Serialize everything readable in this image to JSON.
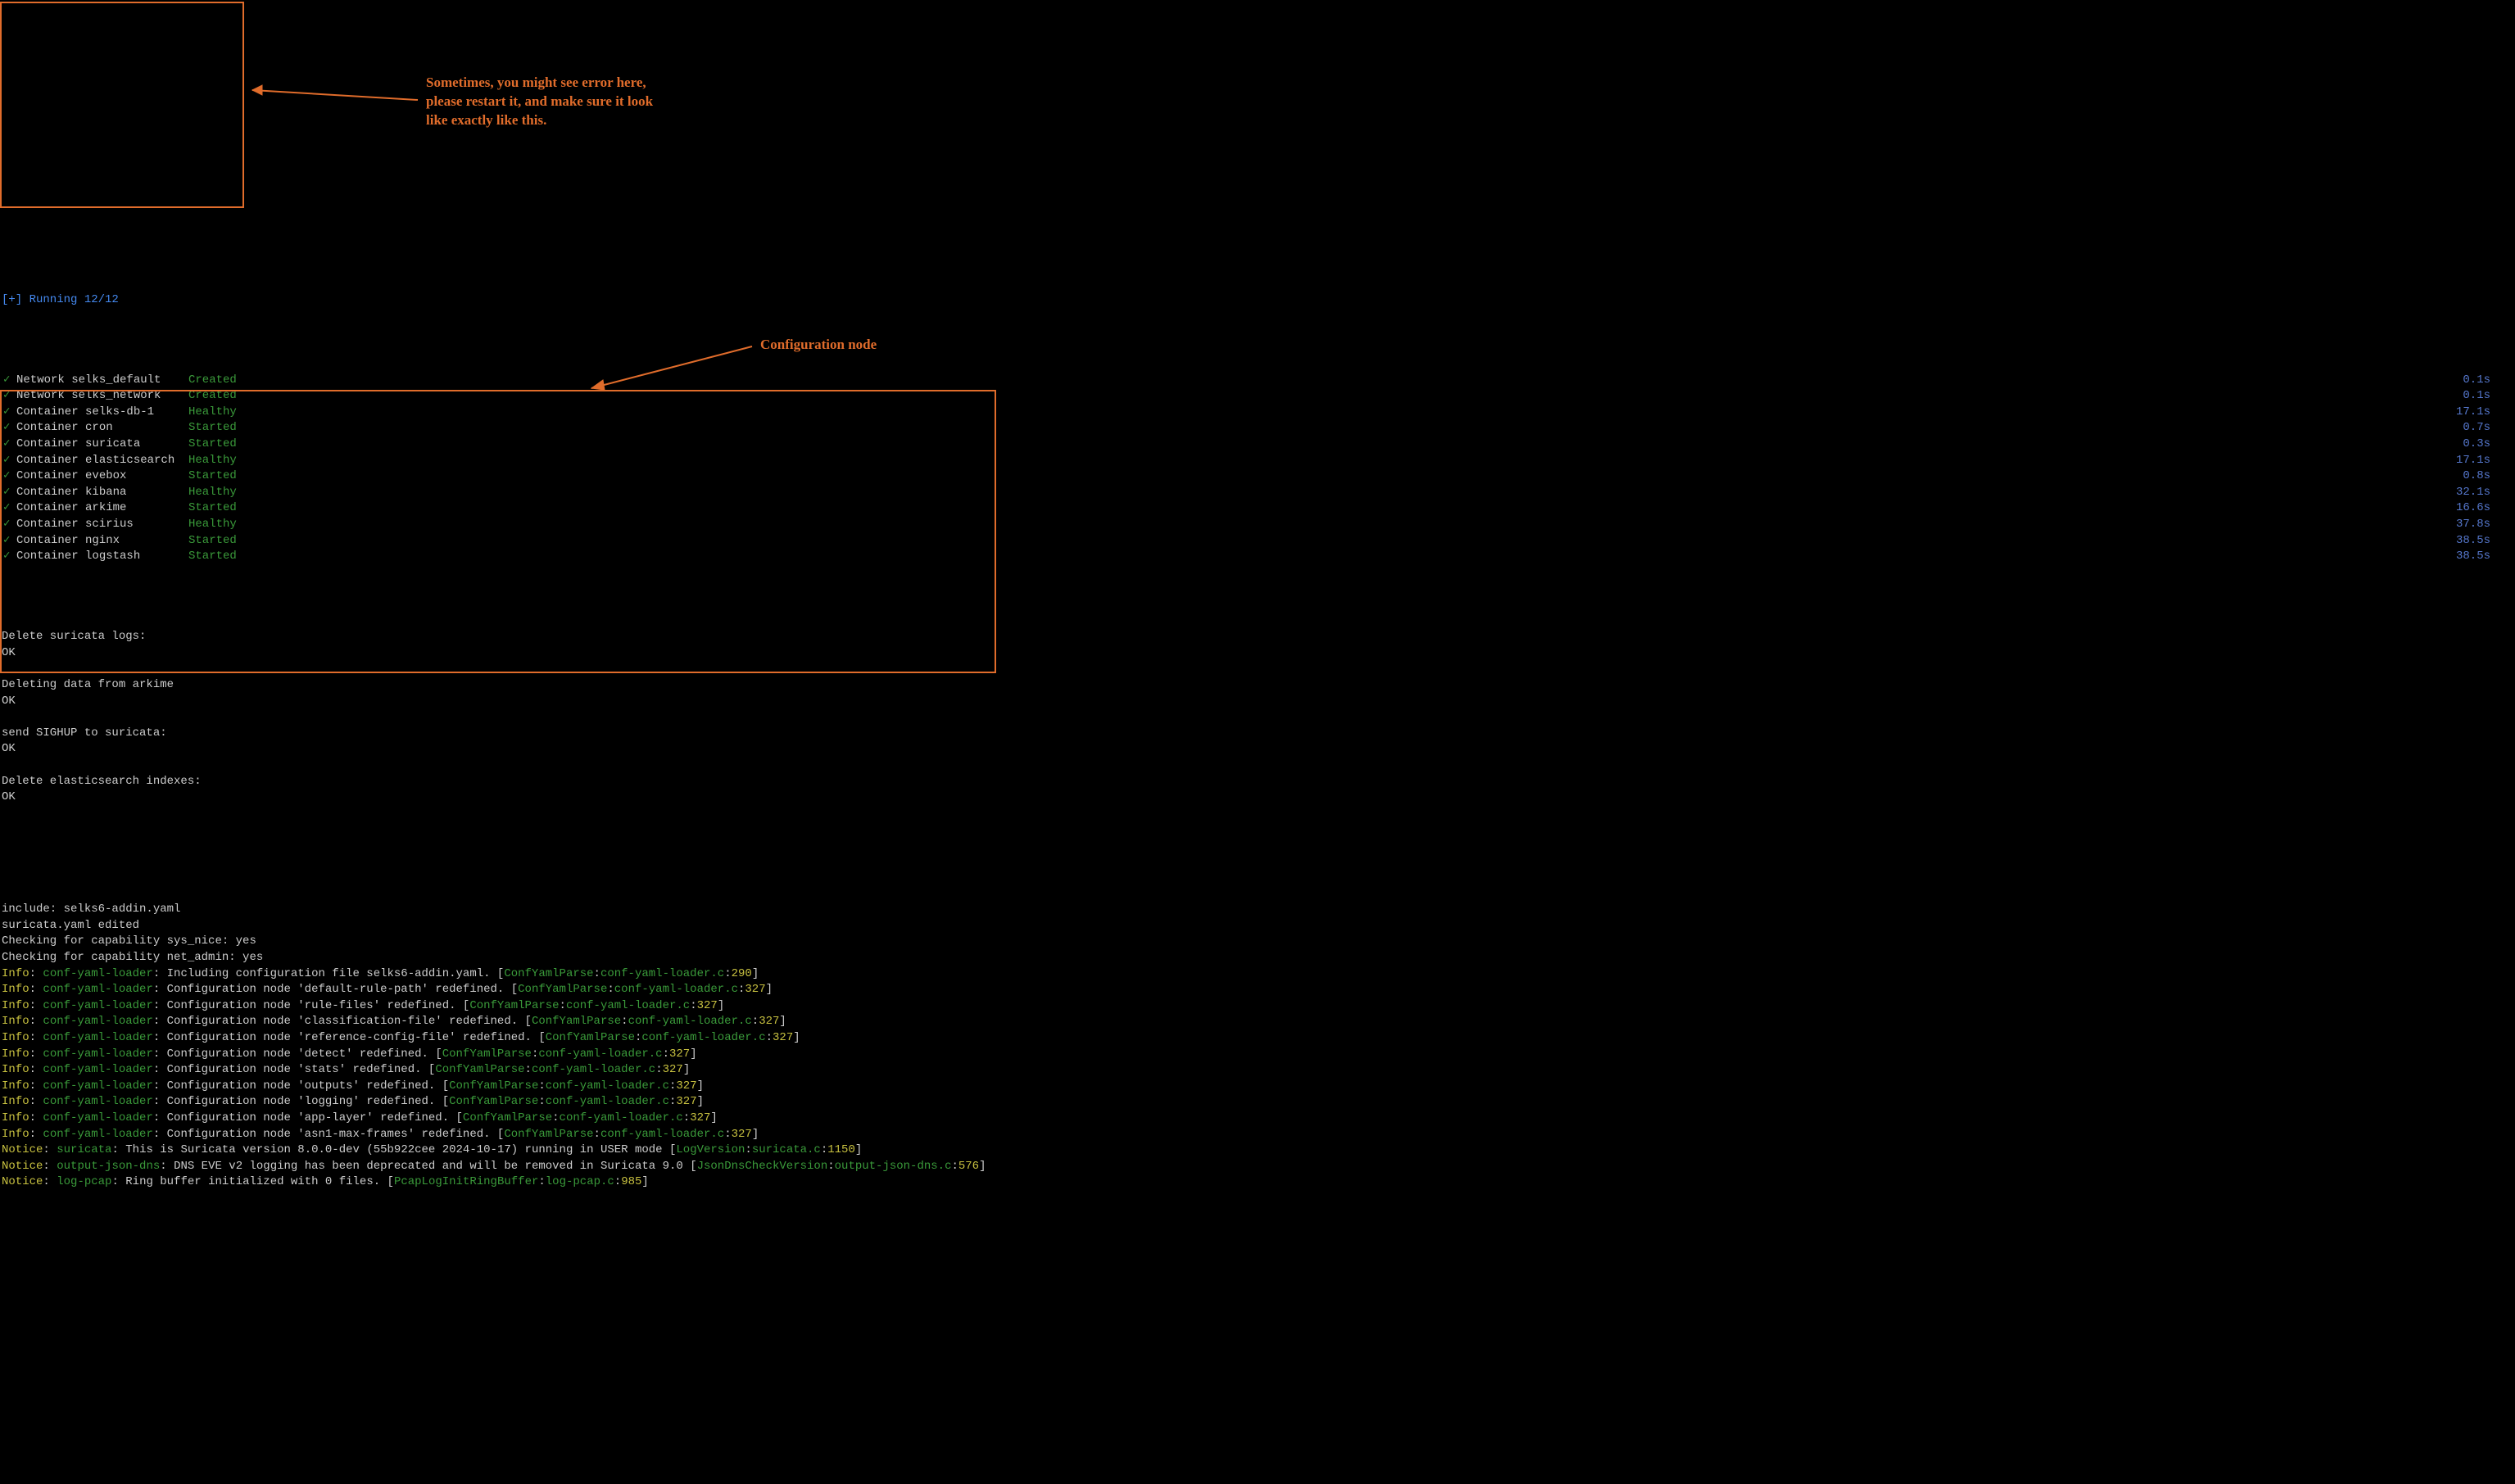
{
  "running": {
    "header": "[+] Running 12/12",
    "services": [
      {
        "name": "Network selks_default",
        "status": "Created",
        "time": "0.1s"
      },
      {
        "name": "Network selks_network",
        "status": "Created",
        "time": "0.1s"
      },
      {
        "name": "Container selks-db-1",
        "status": "Healthy",
        "time": "17.1s"
      },
      {
        "name": "Container cron",
        "status": "Started",
        "time": "0.7s"
      },
      {
        "name": "Container suricata",
        "status": "Started",
        "time": "0.3s"
      },
      {
        "name": "Container elasticsearch",
        "status": "Healthy",
        "time": "17.1s"
      },
      {
        "name": "Container evebox",
        "status": "Started",
        "time": "0.8s"
      },
      {
        "name": "Container kibana",
        "status": "Healthy",
        "time": "32.1s"
      },
      {
        "name": "Container arkime",
        "status": "Started",
        "time": "16.6s"
      },
      {
        "name": "Container scirius",
        "status": "Healthy",
        "time": "37.8s"
      },
      {
        "name": "Container nginx",
        "status": "Started",
        "time": "38.5s"
      },
      {
        "name": "Container logstash",
        "status": "Started",
        "time": "38.5s"
      }
    ]
  },
  "plain_lines": [
    "Delete suricata logs:",
    "OK",
    "",
    "Deleting data from arkime",
    "OK",
    "",
    "send SIGHUP to suricata:",
    "OK",
    "",
    "Delete elasticsearch indexes:",
    "OK",
    "",
    ""
  ],
  "config_pre": [
    "include: selks6-addin.yaml",
    "suricata.yaml edited",
    "Checking for capability sys_nice: yes",
    "Checking for capability net_admin: yes"
  ],
  "config_logs": [
    {
      "level": "Info",
      "component": "conf-yaml-loader",
      "msg": "Including configuration file selks6-addin.yaml.",
      "fn": "ConfYamlParse",
      "file": "conf-yaml-loader.c",
      "line": "290"
    },
    {
      "level": "Info",
      "component": "conf-yaml-loader",
      "msg": "Configuration node 'default-rule-path' redefined.",
      "fn": "ConfYamlParse",
      "file": "conf-yaml-loader.c",
      "line": "327"
    },
    {
      "level": "Info",
      "component": "conf-yaml-loader",
      "msg": "Configuration node 'rule-files' redefined.",
      "fn": "ConfYamlParse",
      "file": "conf-yaml-loader.c",
      "line": "327"
    },
    {
      "level": "Info",
      "component": "conf-yaml-loader",
      "msg": "Configuration node 'classification-file' redefined.",
      "fn": "ConfYamlParse",
      "file": "conf-yaml-loader.c",
      "line": "327"
    },
    {
      "level": "Info",
      "component": "conf-yaml-loader",
      "msg": "Configuration node 'reference-config-file' redefined.",
      "fn": "ConfYamlParse",
      "file": "conf-yaml-loader.c",
      "line": "327"
    },
    {
      "level": "Info",
      "component": "conf-yaml-loader",
      "msg": "Configuration node 'detect' redefined.",
      "fn": "ConfYamlParse",
      "file": "conf-yaml-loader.c",
      "line": "327"
    },
    {
      "level": "Info",
      "component": "conf-yaml-loader",
      "msg": "Configuration node 'stats' redefined.",
      "fn": "ConfYamlParse",
      "file": "conf-yaml-loader.c",
      "line": "327"
    },
    {
      "level": "Info",
      "component": "conf-yaml-loader",
      "msg": "Configuration node 'outputs' redefined.",
      "fn": "ConfYamlParse",
      "file": "conf-yaml-loader.c",
      "line": "327"
    },
    {
      "level": "Info",
      "component": "conf-yaml-loader",
      "msg": "Configuration node 'logging' redefined.",
      "fn": "ConfYamlParse",
      "file": "conf-yaml-loader.c",
      "line": "327"
    },
    {
      "level": "Info",
      "component": "conf-yaml-loader",
      "msg": "Configuration node 'app-layer' redefined.",
      "fn": "ConfYamlParse",
      "file": "conf-yaml-loader.c",
      "line": "327"
    },
    {
      "level": "Info",
      "component": "conf-yaml-loader",
      "msg": "Configuration node 'asn1-max-frames' redefined.",
      "fn": "ConfYamlParse",
      "file": "conf-yaml-loader.c",
      "line": "327"
    },
    {
      "level": "Notice",
      "component": "suricata",
      "msg": "This is Suricata version 8.0.0-dev (55b922cee 2024-10-17) running in USER mode",
      "fn": "LogVersion",
      "file": "suricata.c",
      "line": "1150"
    },
    {
      "level": "Notice",
      "component": "output-json-dns",
      "msg": "DNS EVE v2 logging has been deprecated and will be removed in Suricata 9.0",
      "fn": "JsonDnsCheckVersion",
      "file": "output-json-dns.c",
      "line": "576"
    },
    {
      "level": "Notice",
      "component": "log-pcap",
      "msg": "Ring buffer initialized with 0 files.",
      "fn": "PcapLogInitRingBuffer",
      "file": "log-pcap.c",
      "line": "985"
    }
  ],
  "annotations": {
    "error_note": "Sometimes, you might see error here, please restart it, and make sure it look like exactly like this.",
    "config_note": "Configuration node"
  }
}
